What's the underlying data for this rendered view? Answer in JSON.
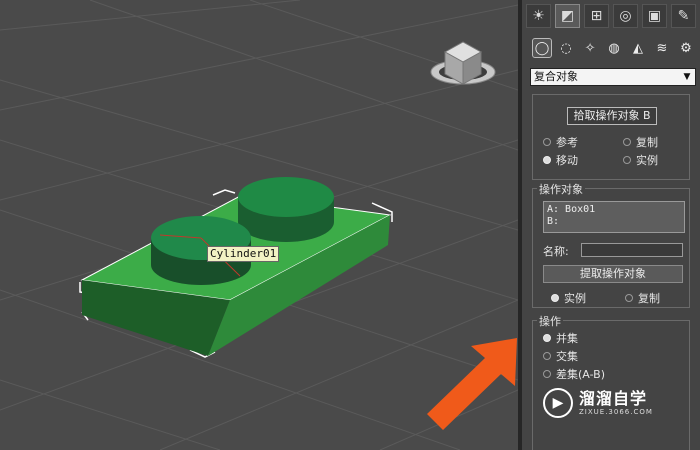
{
  "viewport": {
    "object_label": "Cylinder01"
  },
  "command_panel": {
    "tabs": [
      {
        "icon": "sun-icon",
        "glyph": "☀"
      },
      {
        "icon": "curve-icon",
        "glyph": "◩"
      },
      {
        "icon": "hierarchy-icon",
        "glyph": "⊞"
      },
      {
        "icon": "motion-icon",
        "glyph": "◎"
      },
      {
        "icon": "display-icon",
        "glyph": "▣"
      },
      {
        "icon": "hammer-icon",
        "glyph": "✎"
      }
    ],
    "subtabs": [
      {
        "icon": "geometry-icon",
        "glyph": "◯"
      },
      {
        "icon": "shapes-icon",
        "glyph": "◌"
      },
      {
        "icon": "lights-icon",
        "glyph": "✧"
      },
      {
        "icon": "cameras-icon",
        "glyph": "◍"
      },
      {
        "icon": "helpers-icon",
        "glyph": "◭"
      },
      {
        "icon": "spacewarps-icon",
        "glyph": "≋"
      },
      {
        "icon": "systems-icon",
        "glyph": "⚙"
      }
    ],
    "category_select": "复合对象",
    "pick": {
      "button": "拾取操作对象 B",
      "radio_reference": "参考",
      "radio_copy": "复制",
      "radio_move": "移动",
      "radio_instance": "实例"
    },
    "operands": {
      "title": "操作对象",
      "a": "A: Box01",
      "b": "B:",
      "name_label": "名称:",
      "extract_button": "提取操作对象",
      "radio_instance": "实例",
      "radio_copy": "复制"
    },
    "operation": {
      "title": "操作",
      "union": "并集",
      "intersection": "交集",
      "subtraction": "差集(A-B)"
    }
  },
  "watermark": {
    "title": "溜溜自学",
    "url": "ZIXUE.3066.COM"
  },
  "colors": {
    "box_top": "#3aa848",
    "box_side": "#2a7a32",
    "cylinder_top": "#1f8a45",
    "cylinder_side": "#1a5e30",
    "arrow": "#f05a1a"
  }
}
